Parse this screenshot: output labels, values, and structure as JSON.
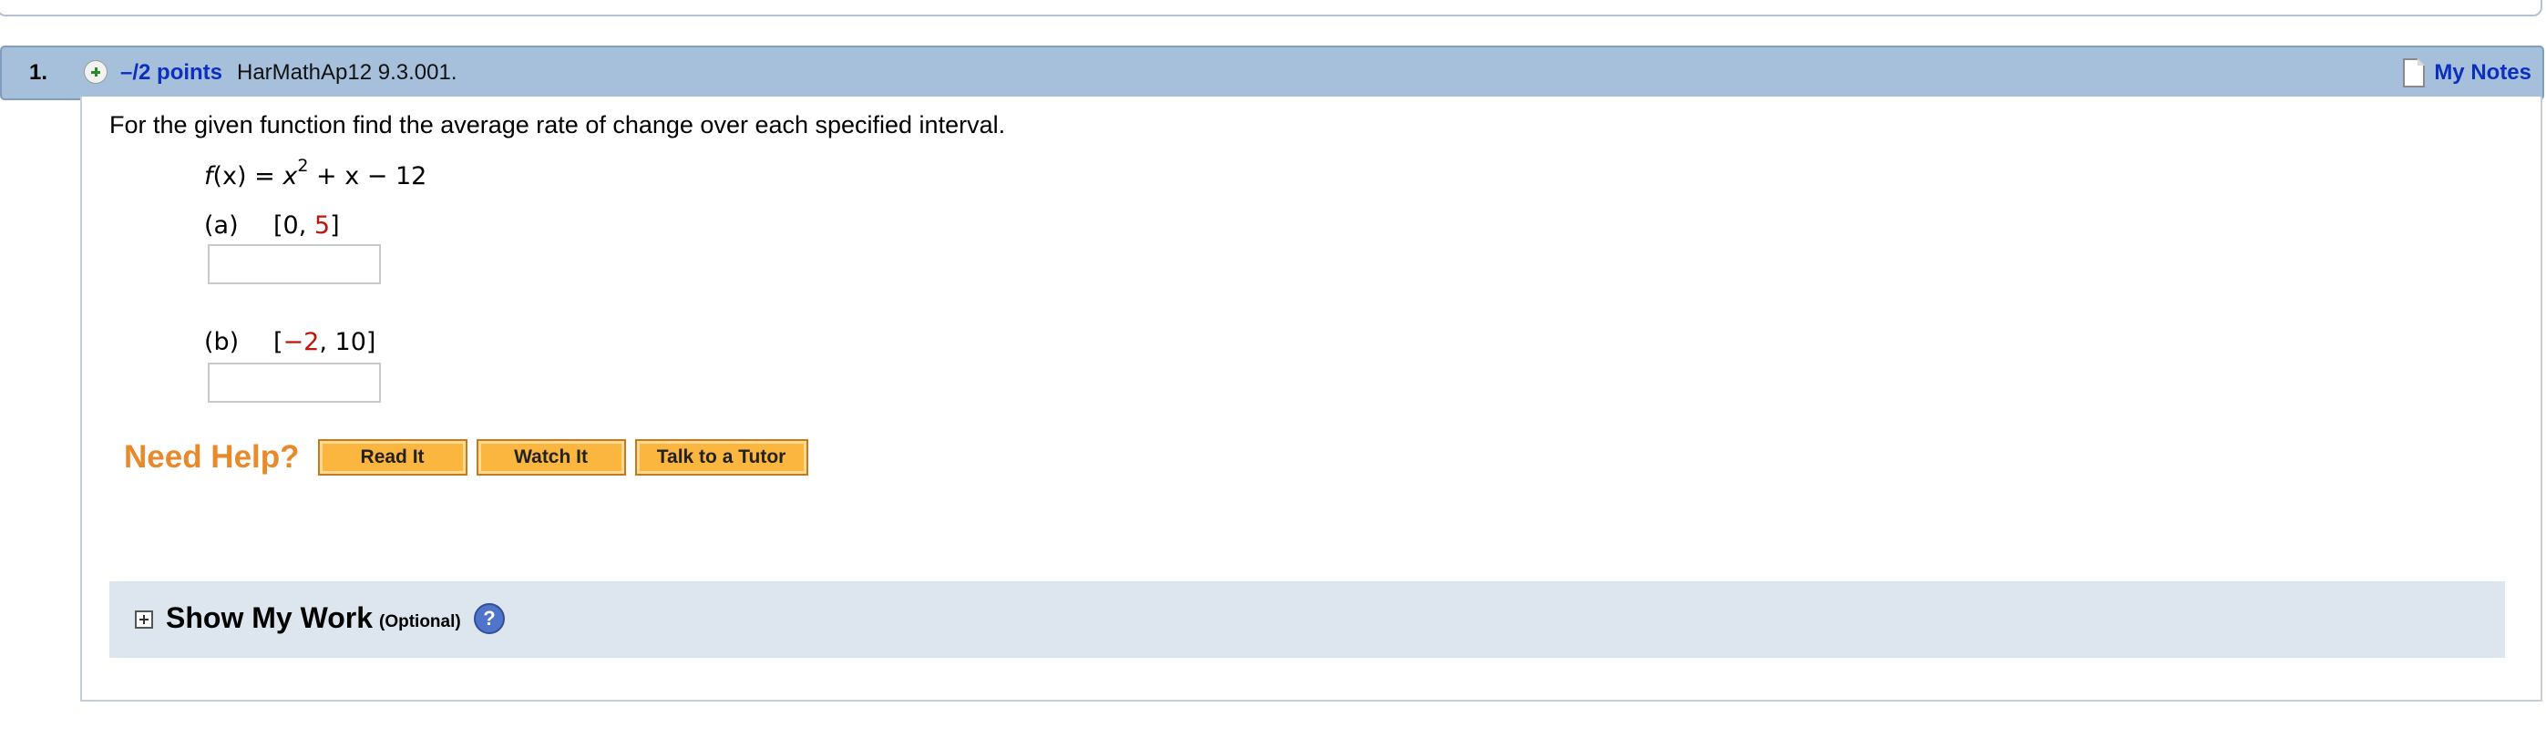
{
  "question": {
    "number": "1.",
    "points": "–/2 points",
    "id": "HarMathAp12 9.3.001.",
    "notes_label": "My Notes"
  },
  "body": {
    "prompt": "For the given function find the average rate of change over each specified interval.",
    "function": {
      "f": "f",
      "x_paren": "(x) = ",
      "x": "x",
      "exp": "2",
      "rest": " + x − 12"
    },
    "part_a": {
      "label": "(a)",
      "open": "[0, ",
      "red": "5",
      "close": "]"
    },
    "part_b": {
      "label": "(b)",
      "open": "[",
      "red": "−2",
      "close": ", 10]"
    },
    "answer_a": "",
    "answer_b": ""
  },
  "help": {
    "label": "Need Help?",
    "read": "Read It",
    "watch": "Watch It",
    "tutor": "Talk to a Tutor"
  },
  "work": {
    "title": "Show My Work",
    "optional": "(Optional)",
    "help_glyph": "?"
  },
  "colors": {
    "header_bg": "#a6c0db",
    "link_blue": "#0c2fc0",
    "help_orange": "#e88a2b",
    "button_orange": "#fbb63f",
    "red_value": "#c0130a",
    "work_bg": "#dde6ee"
  },
  "icons": {
    "expand": "plus-circle-icon",
    "notes": "document-icon",
    "work_expand": "plus-square-icon",
    "help": "question-circle-icon"
  }
}
